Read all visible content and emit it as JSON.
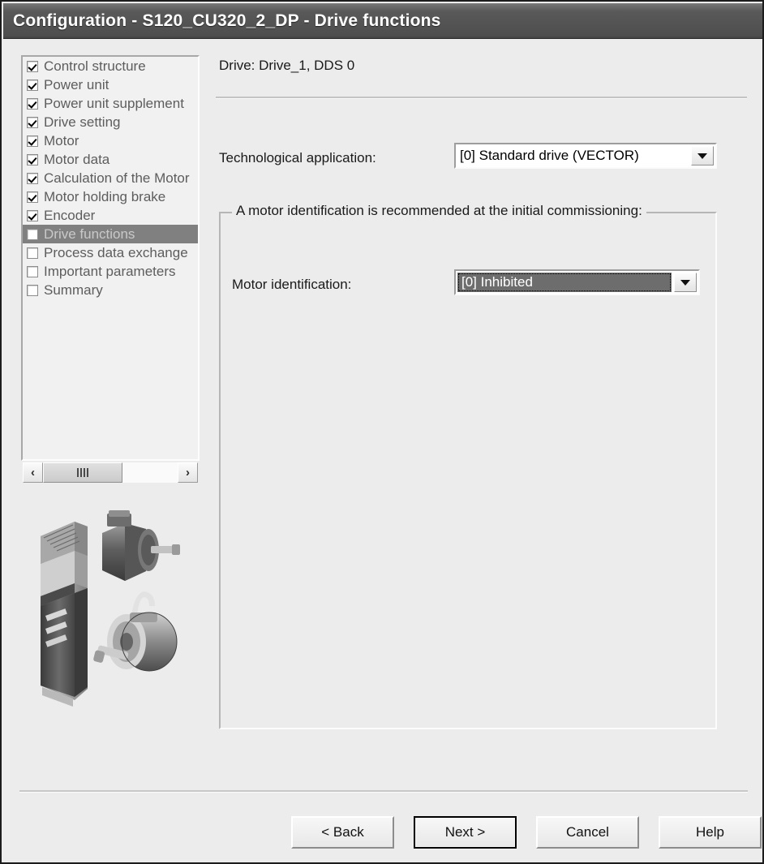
{
  "window": {
    "title": "Configuration - S120_CU320_2_DP - Drive functions"
  },
  "tree": {
    "items": [
      {
        "label": "Control structure",
        "checked": true,
        "selected": false
      },
      {
        "label": "Power unit",
        "checked": true,
        "selected": false
      },
      {
        "label": "Power unit supplement",
        "checked": true,
        "selected": false
      },
      {
        "label": "Drive setting",
        "checked": true,
        "selected": false
      },
      {
        "label": "Motor",
        "checked": true,
        "selected": false
      },
      {
        "label": "Motor data",
        "checked": true,
        "selected": false
      },
      {
        "label": "Calculation of the Motor",
        "checked": true,
        "selected": false
      },
      {
        "label": "Motor holding brake",
        "checked": true,
        "selected": false
      },
      {
        "label": "Encoder",
        "checked": true,
        "selected": false
      },
      {
        "label": "Drive functions",
        "checked": false,
        "selected": true
      },
      {
        "label": "Process data exchange",
        "checked": false,
        "selected": false
      },
      {
        "label": "Important parameters",
        "checked": false,
        "selected": false
      },
      {
        "label": "Summary",
        "checked": false,
        "selected": false
      }
    ],
    "scrollbar": {
      "left_arrow": "‹",
      "right_arrow": "›"
    }
  },
  "content": {
    "header": "Drive: Drive_1, DDS 0",
    "tech_app": {
      "label": "Technological application:",
      "value": "[0] Standard drive (VECTOR)"
    },
    "motor_group": {
      "title": "A motor identification is recommended at the initial commissioning:",
      "motor_id": {
        "label": "Motor identification:",
        "value": "[0] Inhibited"
      }
    }
  },
  "footer": {
    "buttons": [
      {
        "label": "< Back",
        "default": false
      },
      {
        "label": "Next >",
        "default": true
      },
      {
        "label": "Cancel",
        "default": false
      },
      {
        "label": "Help",
        "default": false
      }
    ]
  },
  "colors": {
    "titlebar": "#545454",
    "dialog_bg": "#ececec",
    "selection": "#6d6d6d",
    "tree_selection": "#808080"
  }
}
